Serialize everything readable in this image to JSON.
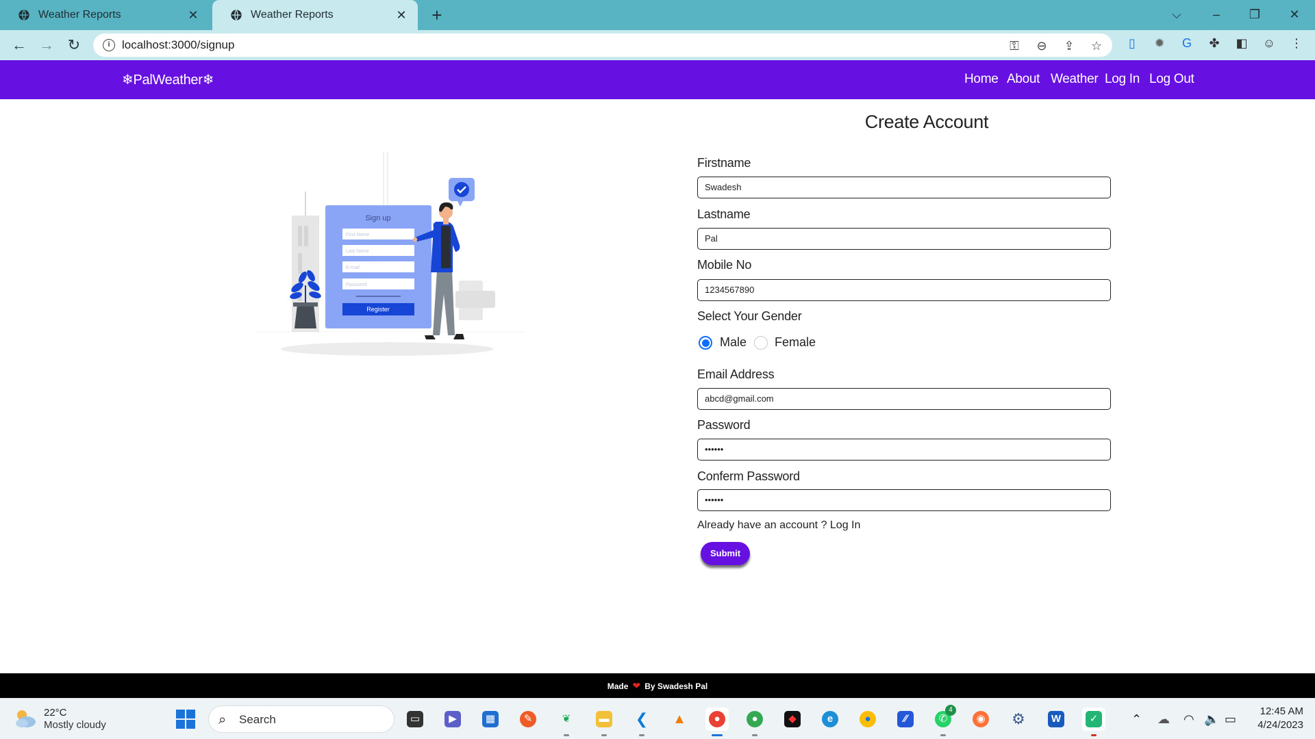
{
  "browser": {
    "tabs": [
      {
        "title": "Weather Reports"
      },
      {
        "title": "Weather Reports"
      }
    ],
    "url": "localhost:3000/signup"
  },
  "site": {
    "brand": "❄PalWeather❄",
    "nav": [
      "Home",
      "About",
      "Weather",
      "Log In",
      "Log Out"
    ]
  },
  "illustration": {
    "card_title": "Sign up",
    "fields": [
      "First Name",
      "Last Name",
      "E-mail",
      "Password"
    ],
    "register_label": "Register"
  },
  "form": {
    "title": "Create Account",
    "firstname_label": "Firstname",
    "firstname_value": "Swadesh",
    "lastname_label": "Lastname",
    "lastname_value": "Pal",
    "mobile_label": "Mobile No",
    "mobile_value": "1234567890",
    "gender_label": "Select Your Gender",
    "gender_options": [
      "Male",
      "Female"
    ],
    "gender_selected": "Male",
    "email_label": "Email Address",
    "email_value": "abcd@gmail.com",
    "password_label": "Password",
    "password_value": "••••••",
    "confirm_label": "Conferm Password",
    "confirm_value": "••••••",
    "login_prompt": "Already have an account ? Log In",
    "submit_label": "Submit"
  },
  "footer": {
    "made": "Made",
    "by": "By Swadesh Pal"
  },
  "taskbar": {
    "weather_temp": "22°C",
    "weather_cond": "Mostly cloudy",
    "search_placeholder": "Search",
    "whatsapp_badge": "4",
    "time": "12:45 AM",
    "date": "4/24/2023"
  },
  "colors": {
    "brand_purple": "#6610e1",
    "tab_bar": "#58b3c3",
    "toolbar": "#c8e9ee",
    "radio_blue": "#0d6efd"
  }
}
